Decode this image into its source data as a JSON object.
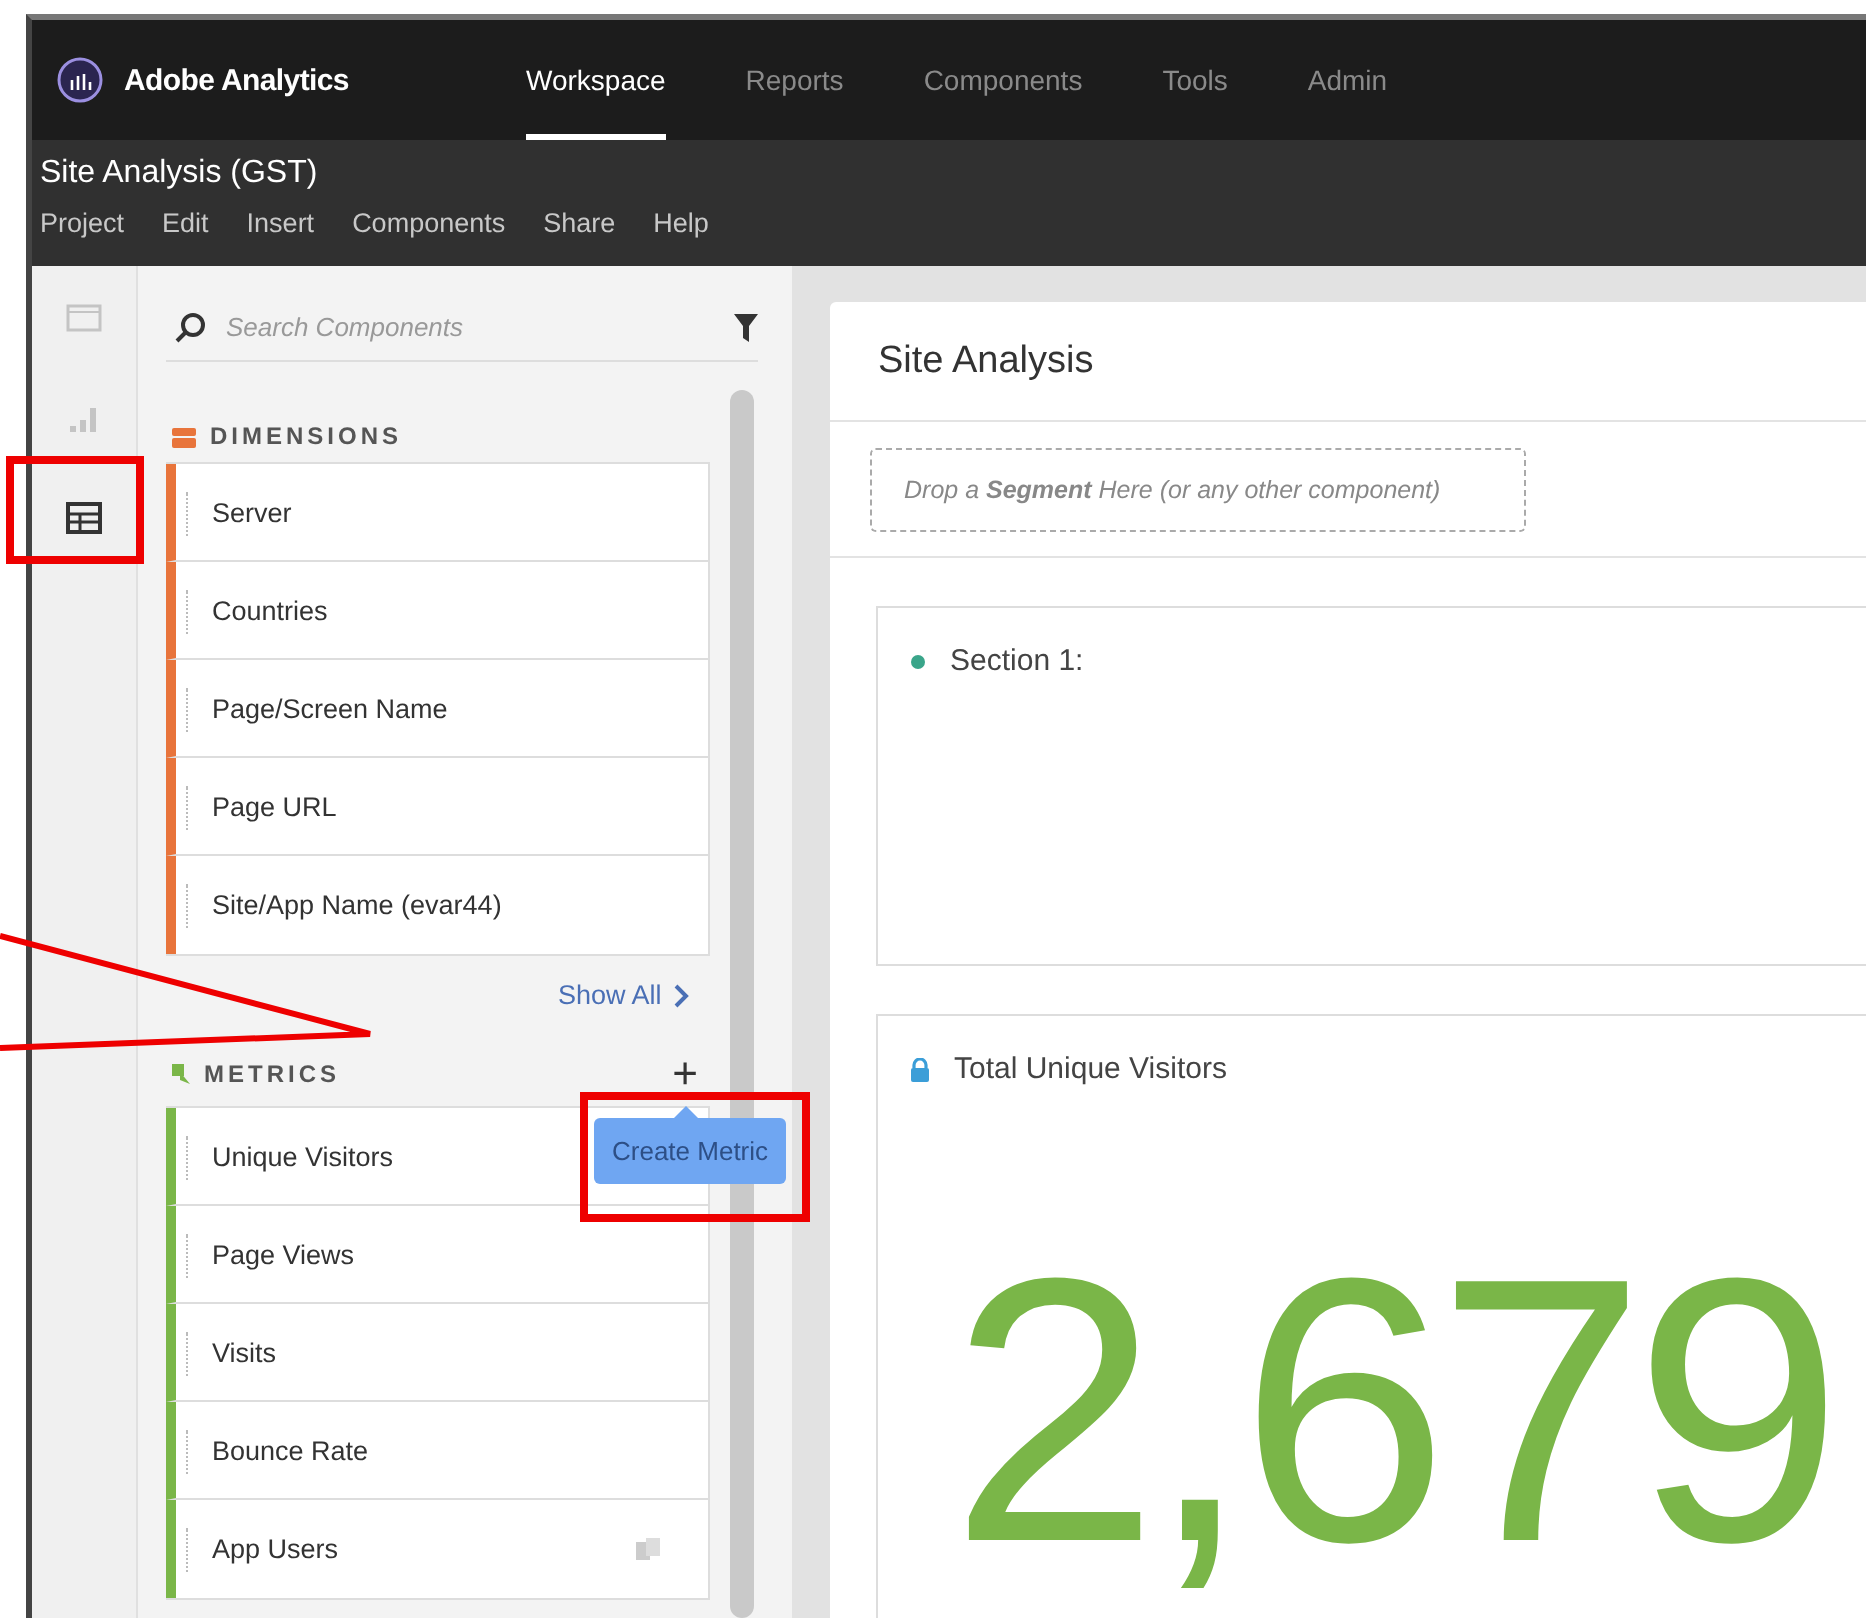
{
  "app": {
    "name": "Adobe Analytics"
  },
  "nav": [
    {
      "label": "Workspace",
      "selected": true
    },
    {
      "label": "Reports",
      "selected": false
    },
    {
      "label": "Components",
      "selected": false
    },
    {
      "label": "Tools",
      "selected": false
    },
    {
      "label": "Admin",
      "selected": false
    }
  ],
  "project": {
    "title": "Site Analysis (GST)",
    "menu": [
      "Project",
      "Edit",
      "Insert",
      "Components",
      "Share",
      "Help"
    ]
  },
  "rail": [
    {
      "kind": "panels",
      "selected": false
    },
    {
      "kind": "visualizations",
      "selected": false
    },
    {
      "kind": "components",
      "selected": true
    }
  ],
  "components_panel": {
    "search": {
      "placeholder": "Search Components"
    },
    "sections": [
      {
        "kind": "dimensions",
        "title": "DIMENSIONS",
        "color": "#e8743b",
        "items": [
          {
            "label": "Server"
          },
          {
            "label": "Countries"
          },
          {
            "label": "Page/Screen Name"
          },
          {
            "label": "Page URL"
          },
          {
            "label": "Site/App Name (evar44)"
          }
        ],
        "show_all": "Show All"
      },
      {
        "kind": "metrics",
        "title": "METRICS",
        "color": "#7ab648",
        "add": "+",
        "tooltip": "Create Metric",
        "items": [
          {
            "label": "Unique Visitors"
          },
          {
            "label": "Page Views"
          },
          {
            "label": "Visits"
          },
          {
            "label": "Bounce Rate"
          },
          {
            "label": "App Users",
            "shared": true
          }
        ]
      }
    ]
  },
  "workspace": {
    "title": "Site Analysis",
    "drop_zone": "Drop a **Segment** Here (or any other component)",
    "panels": [
      {
        "kind": "section",
        "title": "Section 1:"
      },
      {
        "kind": "freeform",
        "title": "Total Unique Visitors",
        "value": "2,679"
      }
    ]
  }
}
